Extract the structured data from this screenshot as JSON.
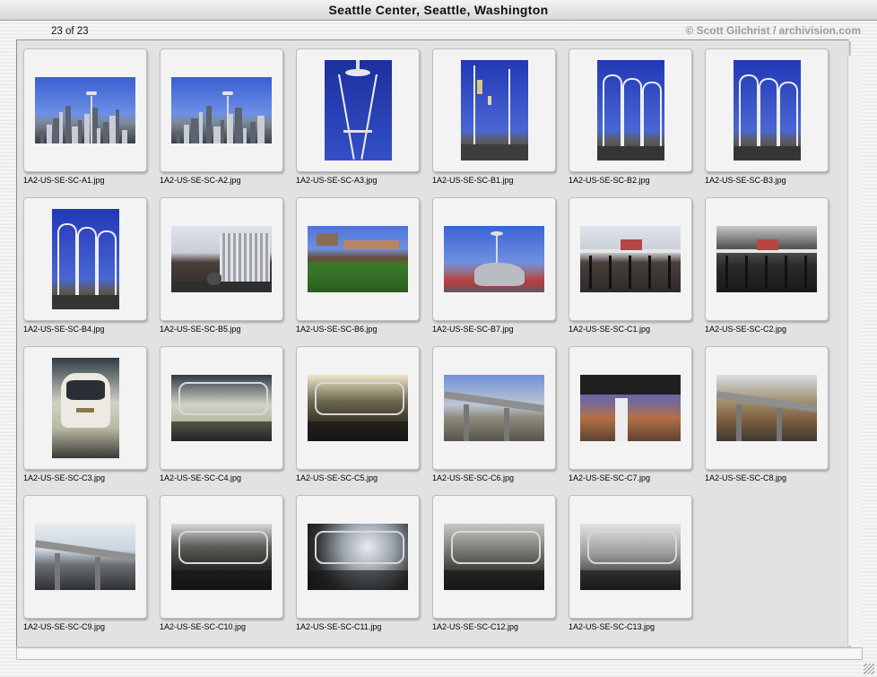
{
  "window": {
    "title": "Seattle Center, Seattle, Washington"
  },
  "header": {
    "count": "23 of 23",
    "copyright": "© Scott Gilchrist / archivision.com"
  },
  "thumbnails": [
    {
      "file": "1A2-US-SE-SC-A1.jpg"
    },
    {
      "file": "1A2-US-SE-SC-A2.jpg"
    },
    {
      "file": "1A2-US-SE-SC-A3.jpg"
    },
    {
      "file": "1A2-US-SE-SC-B1.jpg"
    },
    {
      "file": "1A2-US-SE-SC-B2.jpg"
    },
    {
      "file": "1A2-US-SE-SC-B3.jpg"
    },
    {
      "file": "1A2-US-SE-SC-B4.jpg"
    },
    {
      "file": "1A2-US-SE-SC-B5.jpg"
    },
    {
      "file": "1A2-US-SE-SC-B6.jpg"
    },
    {
      "file": "1A2-US-SE-SC-B7.jpg"
    },
    {
      "file": "1A2-US-SE-SC-C1.jpg"
    },
    {
      "file": "1A2-US-SE-SC-C2.jpg"
    },
    {
      "file": "1A2-US-SE-SC-C3.jpg"
    },
    {
      "file": "1A2-US-SE-SC-C4.jpg"
    },
    {
      "file": "1A2-US-SE-SC-C5.jpg"
    },
    {
      "file": "1A2-US-SE-SC-C6.jpg"
    },
    {
      "file": "1A2-US-SE-SC-C7.jpg"
    },
    {
      "file": "1A2-US-SE-SC-C8.jpg"
    },
    {
      "file": "1A2-US-SE-SC-C9.jpg"
    },
    {
      "file": "1A2-US-SE-SC-C10.jpg"
    },
    {
      "file": "1A2-US-SE-SC-C11.jpg"
    },
    {
      "file": "1A2-US-SE-SC-C12.jpg"
    },
    {
      "file": "1A2-US-SE-SC-C13.jpg"
    }
  ]
}
